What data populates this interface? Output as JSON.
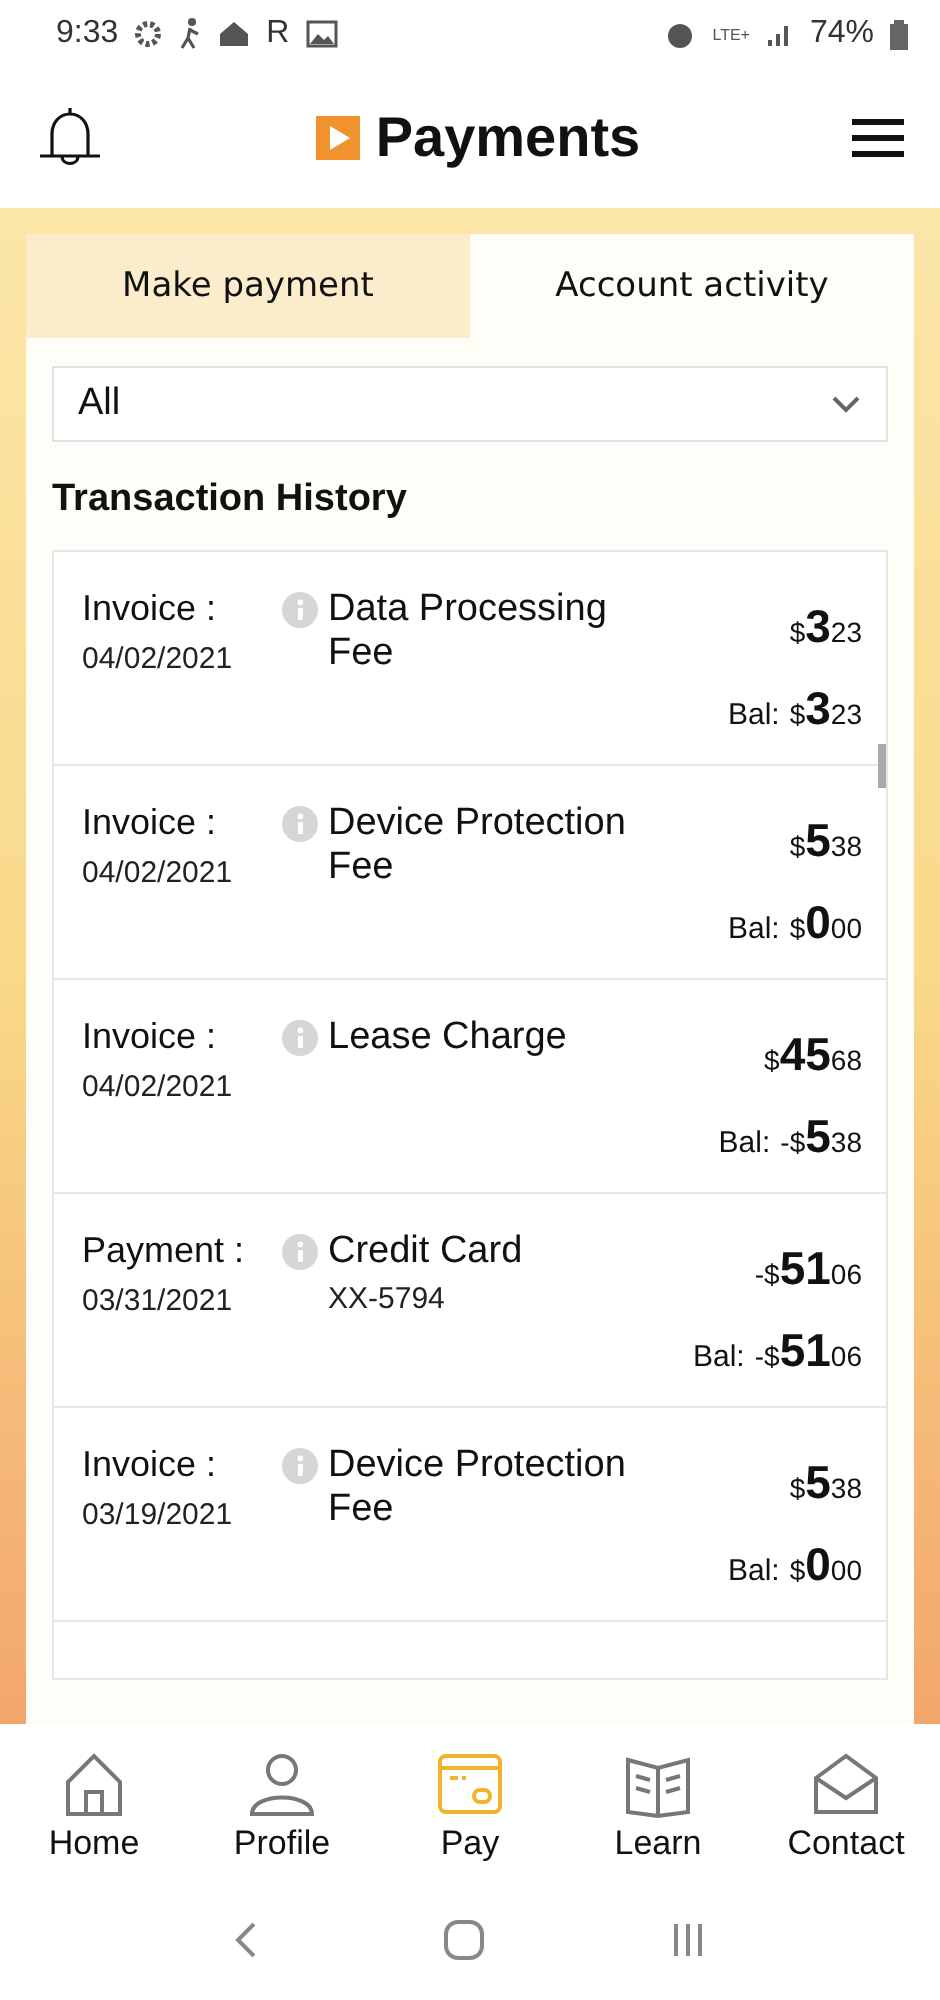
{
  "status_bar": {
    "time": "9:33",
    "letter": "R",
    "network": "LTE+",
    "battery": "74%"
  },
  "header": {
    "title": "Payments"
  },
  "tabs": [
    {
      "label": "Make payment",
      "selected": false
    },
    {
      "label": "Account activity",
      "selected": true
    }
  ],
  "filter": {
    "value": "All"
  },
  "section_title": "Transaction History",
  "transactions": [
    {
      "type": "Invoice :",
      "date": "04/02/2021",
      "description": "Data Processing Fee",
      "amount": {
        "currency": "$",
        "whole": "3",
        "cents": "23"
      },
      "balance_label": "Bal:",
      "balance": {
        "currency": "$",
        "whole": "3",
        "cents": "23"
      }
    },
    {
      "type": "Invoice :",
      "date": "04/02/2021",
      "description": "Device Protection Fee",
      "amount": {
        "currency": "$",
        "whole": "5",
        "cents": "38"
      },
      "balance_label": "Bal:",
      "balance": {
        "currency": "$",
        "whole": "0",
        "cents": "00"
      }
    },
    {
      "type": "Invoice :",
      "date": "04/02/2021",
      "description": "Lease Charge",
      "amount": {
        "currency": "$",
        "whole": "45",
        "cents": "68"
      },
      "balance_label": "Bal:",
      "balance": {
        "sign": "-",
        "currency": "$",
        "whole": "5",
        "cents": "38"
      }
    },
    {
      "type": "Payment :",
      "date": "03/31/2021",
      "description": "Credit Card",
      "detail": "XX-5794",
      "amount": {
        "sign": "-",
        "currency": "$",
        "whole": "51",
        "cents": "06"
      },
      "balance_label": "Bal:",
      "balance": {
        "sign": "-",
        "currency": "$",
        "whole": "51",
        "cents": "06"
      }
    },
    {
      "type": "Invoice :",
      "date": "03/19/2021",
      "description": "Device Protection Fee",
      "amount": {
        "currency": "$",
        "whole": "5",
        "cents": "38"
      },
      "balance_label": "Bal:",
      "balance": {
        "currency": "$",
        "whole": "0",
        "cents": "00"
      }
    }
  ],
  "bottom_nav": [
    {
      "kind": "home",
      "label": "Home",
      "selected": false
    },
    {
      "kind": "profile",
      "label": "Profile",
      "selected": false
    },
    {
      "kind": "pay",
      "label": "Pay",
      "selected": true
    },
    {
      "kind": "learn",
      "label": "Learn",
      "selected": false
    },
    {
      "kind": "contact",
      "label": "Contact",
      "selected": false
    }
  ]
}
